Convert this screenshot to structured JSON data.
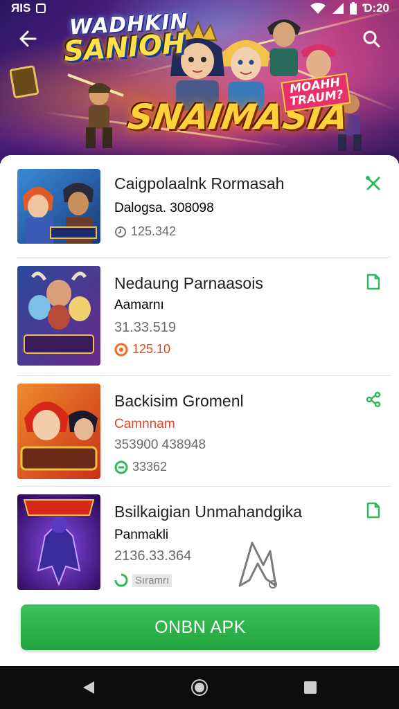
{
  "status_bar": {
    "left_text": "ЯIS",
    "time": "Ɗ:20",
    "icons": [
      "square-icon",
      "wifi-icon",
      "signal-icon",
      "battery-icon"
    ]
  },
  "header": {
    "back_icon": "arrow-left-icon",
    "search_icon": "search-icon"
  },
  "banner": {
    "logo_top": "WADHKIN",
    "logo_sub": "SANIOH",
    "logo_main": "SNAIMASIA",
    "tag": "MOAHH TRAUM?"
  },
  "apps": [
    {
      "title": "Caigpolaalnk Rormasah",
      "subtitle": "Dalogsa. 308098",
      "subtitle_color": "#707070",
      "meta_line": "",
      "meta_icon": "clock-icon",
      "meta_icon_color": "#777777",
      "meta": "125.342",
      "meta_color": "#707070",
      "action_icon": "tools-icon"
    },
    {
      "title": "Nedaung Parnaasois",
      "subtitle": "Aamarnı",
      "subtitle_color": "#707070",
      "meta_line": "31.33.519",
      "meta_icon": "record-icon",
      "meta_icon_color": "#f26a1b",
      "meta": "125.10",
      "meta_color": "#e24a18",
      "action_icon": "file-icon"
    },
    {
      "title": "Backisim Gromenl",
      "subtitle": "Camnnam",
      "subtitle_color": "#e2452f",
      "meta_line": "353900 438948",
      "meta_icon": "minus-circle-icon",
      "meta_icon_color": "#2fb85a",
      "meta": "33362",
      "meta_color": "#707070",
      "action_icon": "share-icon"
    },
    {
      "title": "Bsilkaigian Unmahandgika",
      "subtitle": "Panmakli",
      "subtitle_color": "#707070",
      "meta_line": "2136.33.364",
      "meta_icon": "loading-icon",
      "meta_icon_color": "#2fb85a",
      "meta": "Sıramrı",
      "meta_color": "#8a8a8a",
      "action_icon": "file-icon"
    }
  ],
  "cta": {
    "label": "ONBN APK"
  },
  "nav": {
    "back": "back-triangle-icon",
    "home": "home-circle-icon",
    "recents": "recents-square-icon"
  },
  "colors": {
    "accent": "#22a33e",
    "action_icon": "#2fb85a"
  }
}
